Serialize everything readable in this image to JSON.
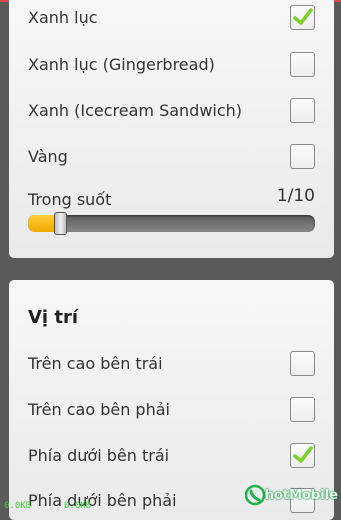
{
  "colors": {
    "accent": "#f5b400",
    "check": "#7bd02b",
    "card_bg": "#f2f2f2",
    "screen_bg": "#5a5a5a"
  },
  "colors_section": {
    "items": [
      {
        "label": "Xanh lục",
        "checked": true
      },
      {
        "label": "Xanh lục (Gingerbread)",
        "checked": false
      },
      {
        "label": "Xanh (Icecream Sandwich)",
        "checked": false
      },
      {
        "label": "Vàng",
        "checked": false
      }
    ],
    "transparency": {
      "label": "Trong suốt",
      "value_text": "1/10",
      "value": 1,
      "max": 10
    }
  },
  "position_section": {
    "title": "Vị trí",
    "items": [
      {
        "label": "Trên cao bên trái",
        "checked": false
      },
      {
        "label": "Trên cao bên phải",
        "checked": false
      },
      {
        "label": "Phía dưới bên trái",
        "checked": true
      },
      {
        "label": "Phía dưới bên phải",
        "checked": false
      }
    ]
  },
  "overlay": {
    "debug_left": "0.0KB",
    "debug_mid": "0.0KB",
    "watermark": "hotMobile",
    "watermark_icon": "phone-icon"
  }
}
